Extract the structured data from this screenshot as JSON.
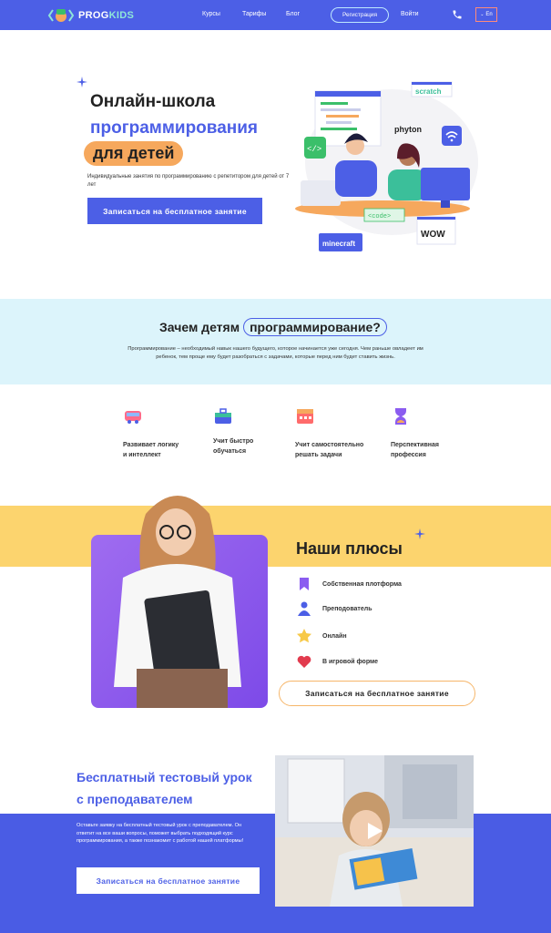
{
  "header": {
    "logo_prefix": "PROG",
    "logo_suffix": "KIDS",
    "nav": [
      "Курсы",
      "Тарифы",
      "Блог"
    ],
    "register_label": "Регистрация",
    "login_label": "Войти",
    "lang_label": "En"
  },
  "hero": {
    "title_line1": "Онлайн-школа",
    "title_line2": "программирования",
    "title_line3": "для детей",
    "subtitle": "Индивидуальные занятия по программированию с репетитором для детей от 7 лет",
    "cta": "Записаться на бесплатное занятие",
    "tags": {
      "scratch": "scratch",
      "phyton": "phyton",
      "code": "<code>",
      "minecraft": "minecraft",
      "wow": "WOW"
    }
  },
  "why": {
    "title_prefix": "Зачем детям",
    "title_highlight": "программирование?",
    "text": "Программирование – необходимый навык нашего будущего, которое начинается уже сегодня. Чем раньше овладеет им ребенок, тем проще ему будет разобраться с задачами, которые перед ним будет ставить жизнь."
  },
  "features": [
    {
      "label_1": "Развивает логику",
      "label_2": "и интеллект"
    },
    {
      "label_1": "Учит быстро",
      "label_2": "обучаться"
    },
    {
      "label_1": "Учит самостоятельно",
      "label_2": "решать задачи"
    },
    {
      "label_1": "Перспективная",
      "label_2": "профессия"
    }
  ],
  "pluses": {
    "title": "Наши плюсы",
    "items": [
      "Собственная плотформа",
      "Преподователь",
      "Онлайн",
      "В игровой форме"
    ],
    "cta": "Записаться на бесплатное занятие"
  },
  "trial": {
    "title": "Бесплатный тестовый урок с преподавателем",
    "text": "Оставьте заявку на бесплатный тестовый урок с преподавателем. Он ответит на все ваши вопросы, поможет выбрать подходящий курс программирования, а также познакомит с работой нашей платформы!",
    "cta": "Записаться на бесплатное занятие"
  },
  "colors": {
    "brand_blue": "#4c5fe6",
    "light_blue": "#dcf4fb",
    "yellow": "#fcd46e",
    "orange": "#f6a85d",
    "purple": "#8b5cf0"
  }
}
